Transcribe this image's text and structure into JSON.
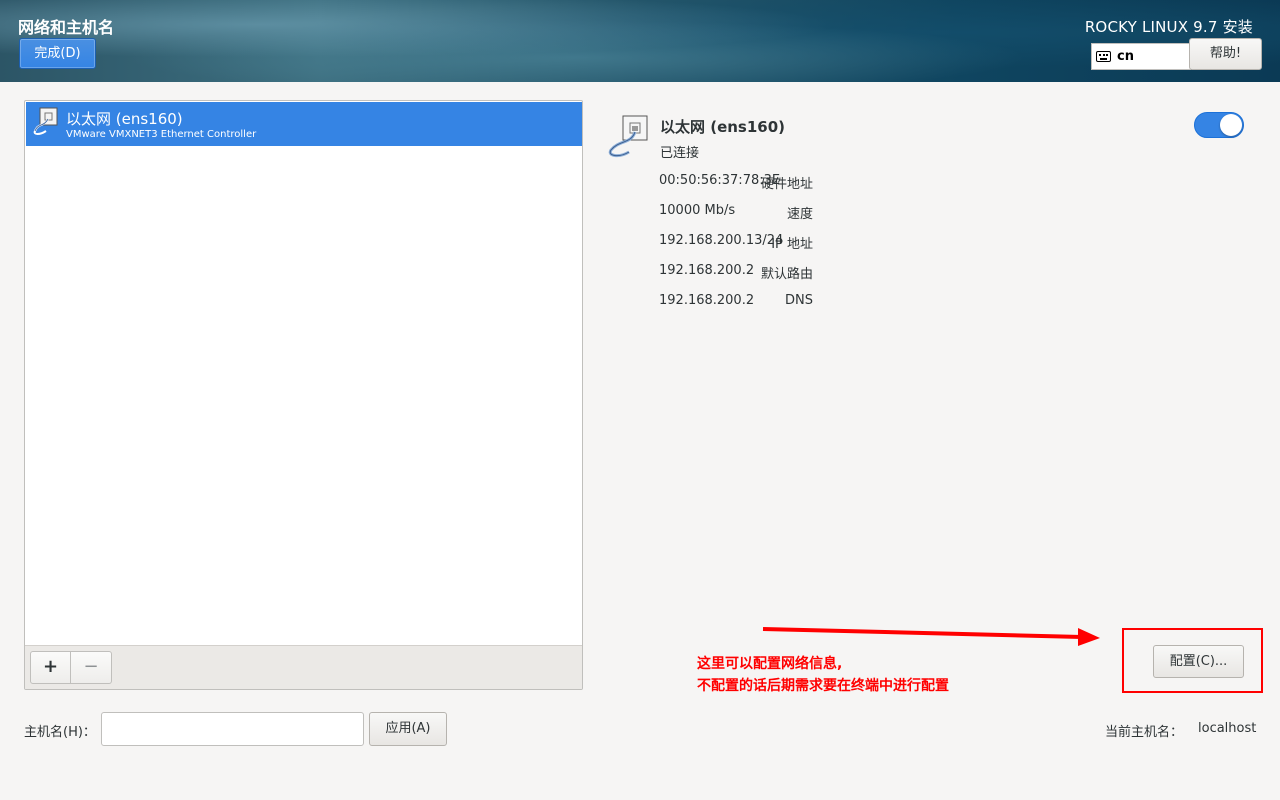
{
  "header": {
    "title": "网络和主机名",
    "done_label": "完成(D)",
    "product": "ROCKY LINUX 9.7 安装",
    "keyboard_layout": "cn",
    "help_label": "帮助!"
  },
  "device_list": {
    "devices": [
      {
        "name": "以太网 (ens160)",
        "description": "VMware VMXNET3 Ethernet Controller",
        "selected": true
      }
    ],
    "add_label": "+",
    "remove_label": "−"
  },
  "details": {
    "name": "以太网 (ens160)",
    "status": "已连接",
    "enabled": true,
    "rows": [
      {
        "label": "硬件地址",
        "value": "00:50:56:37:78:3E"
      },
      {
        "label": "速度",
        "value": "10000 Mb/s"
      },
      {
        "label": "IP 地址",
        "value": "192.168.200.13/24"
      },
      {
        "label": "默认路由",
        "value": "192.168.200.2"
      },
      {
        "label": "DNS",
        "value": "192.168.200.2"
      }
    ],
    "configure_label": "配置(C)..."
  },
  "annotation": {
    "line1": "这里可以配置网络信息,",
    "line2": "不配置的话后期需求要在终端中进行配置"
  },
  "hostname": {
    "label": "主机名(H)：",
    "value": "",
    "placeholder": "",
    "apply_label": "应用(A)",
    "current_label": "当前主机名：",
    "current_value": "localhost"
  },
  "colors": {
    "accent": "#3584e4",
    "annotation": "#ff0000"
  },
  "icons": {
    "device": "ethernet-cable-icon",
    "keyboard": "keyboard-icon"
  }
}
